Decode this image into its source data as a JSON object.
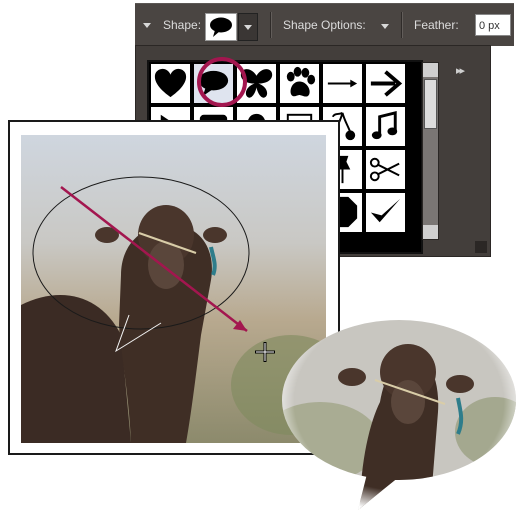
{
  "options_bar": {
    "shape_label": "Shape:",
    "shape_options_label": "Shape Options:",
    "feather_label": "Feather:",
    "feather_value": "0 px"
  },
  "shape_picker": {
    "selected_shape": "speech-bubble",
    "shapes": [
      "heart",
      "speech-bubble",
      "butterfly",
      "paw",
      "arrow-thin",
      "arrow-bold",
      "triangle",
      "speech-bubble-2",
      "circle",
      "frame",
      "cherries",
      "music-note",
      "blank",
      "blank",
      "blank",
      "blank",
      "pushpin",
      "scissors",
      "blank",
      "blank",
      "blank",
      "octagon",
      "checkmark",
      "blank"
    ]
  },
  "accent_color": "#a3164f"
}
